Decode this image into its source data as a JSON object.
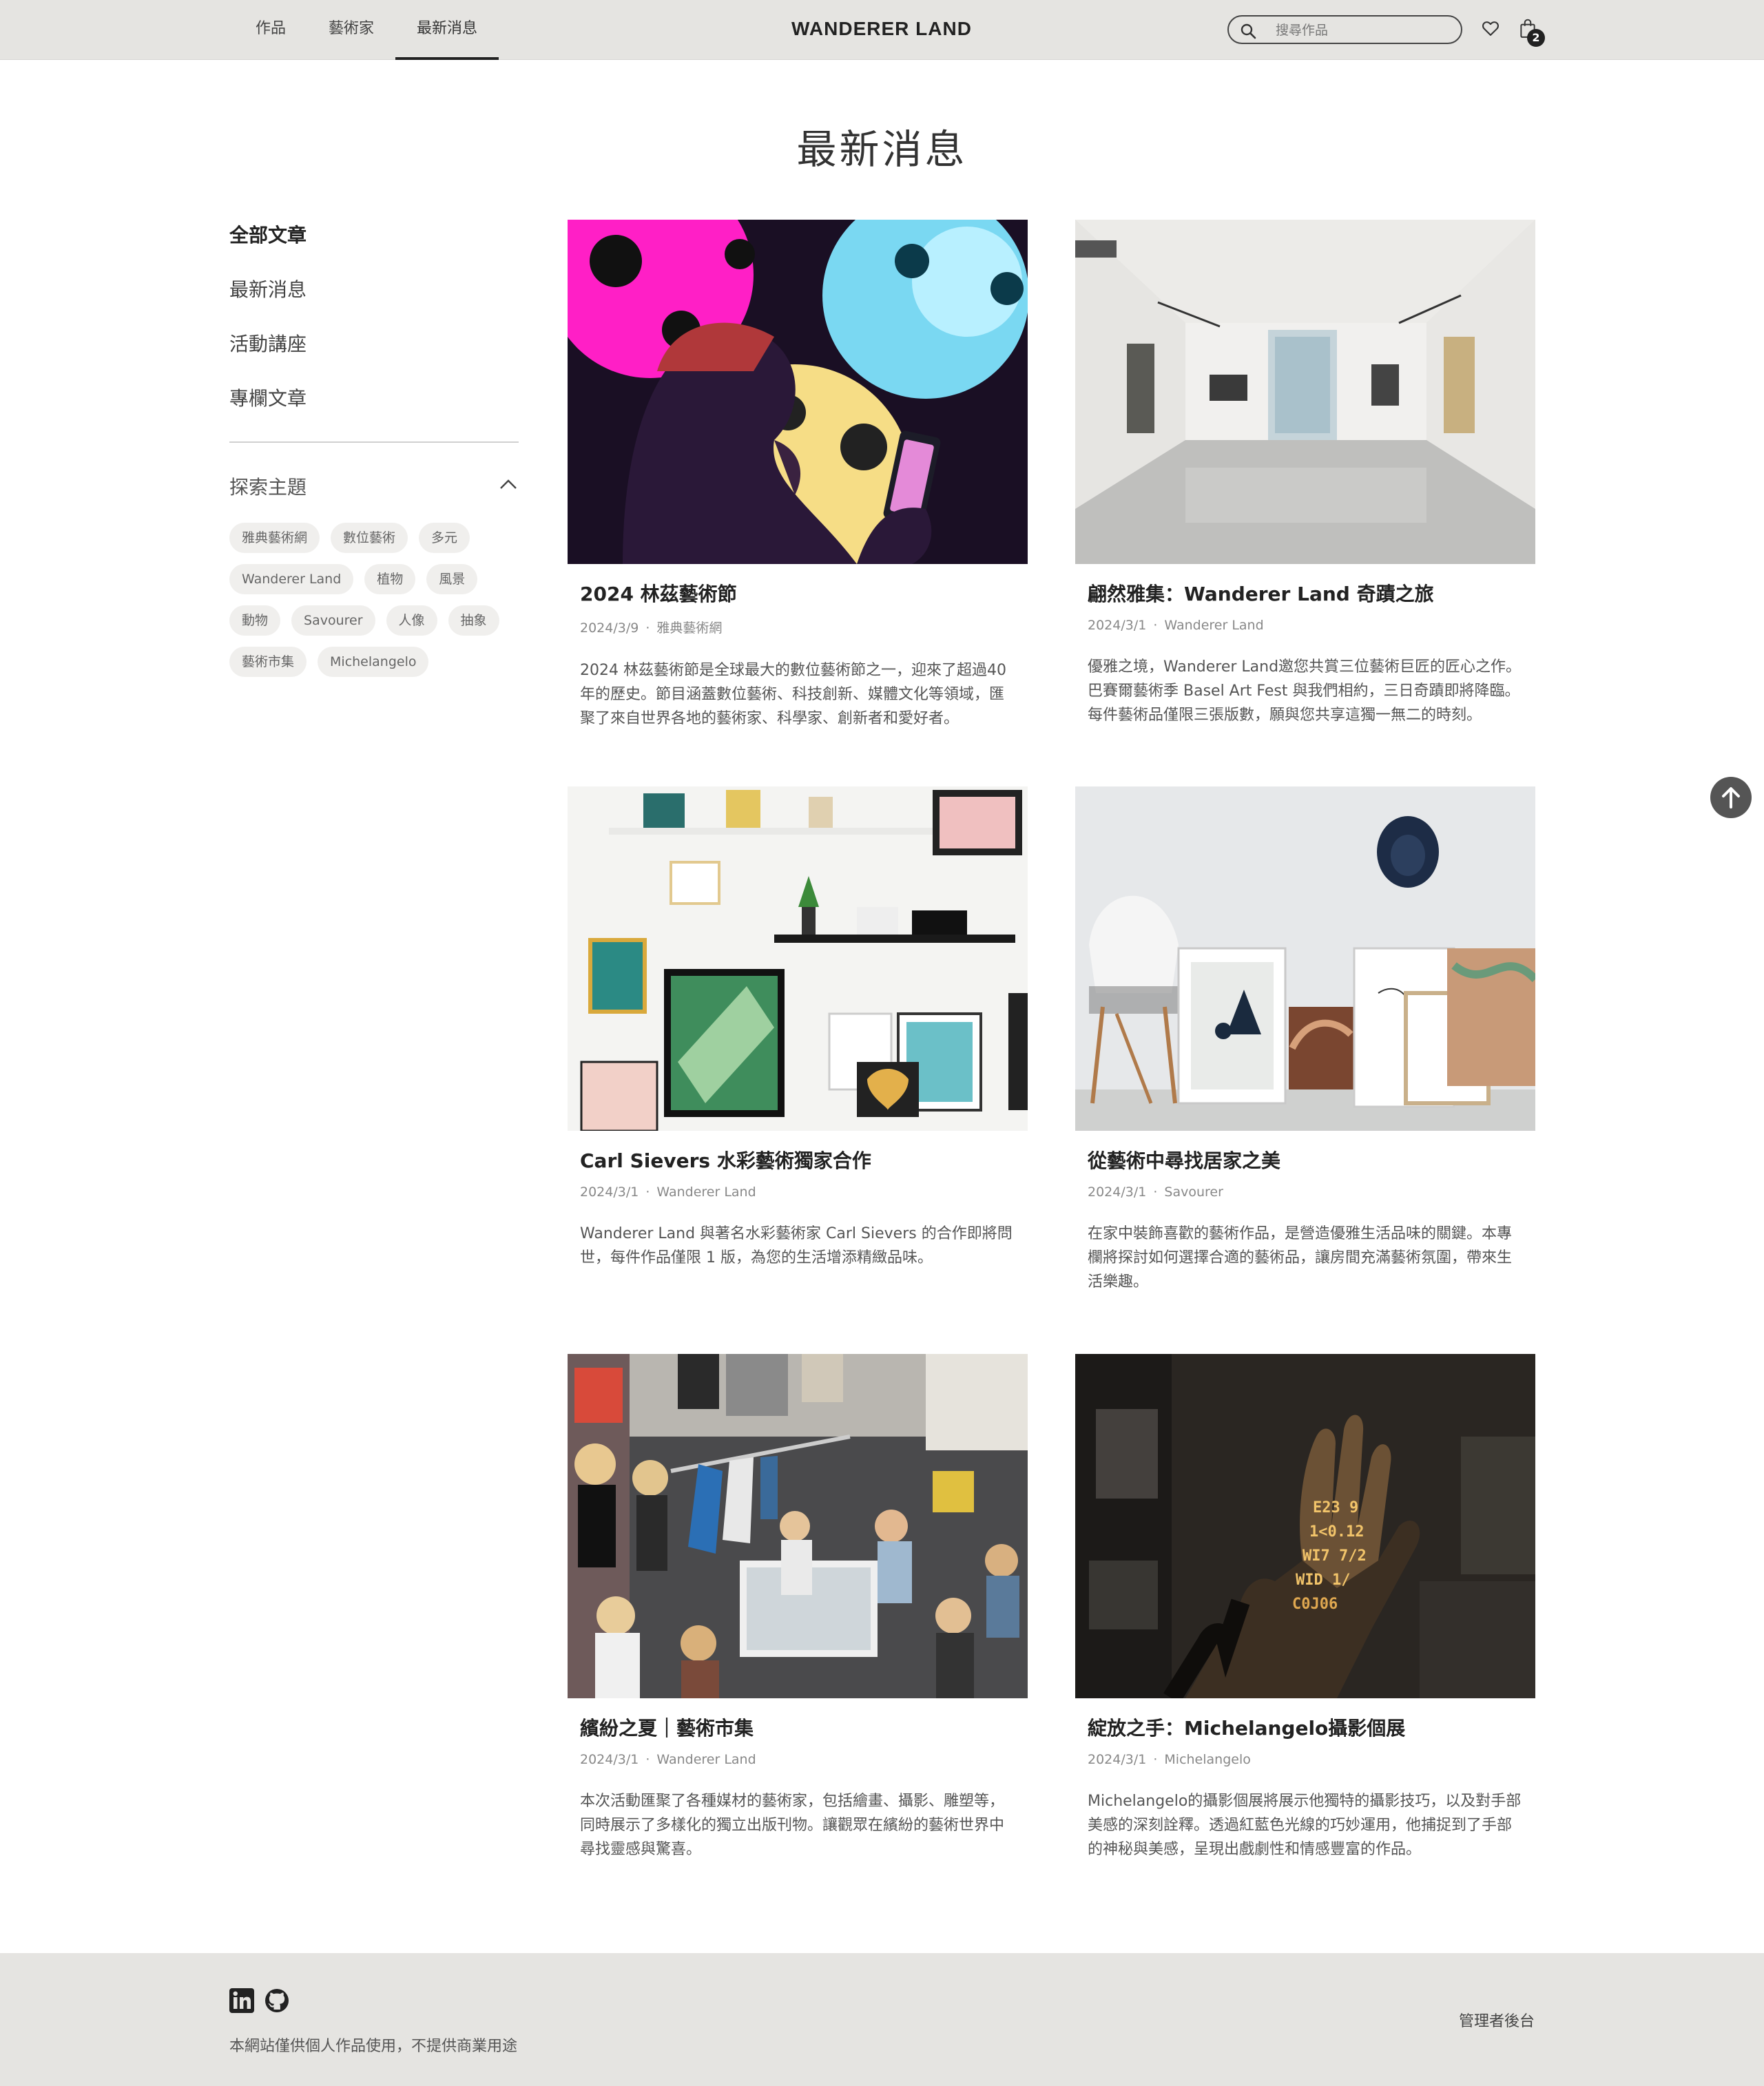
{
  "header": {
    "nav": [
      "作品",
      "藝術家",
      "最新消息"
    ],
    "brand": "WANDERER LAND",
    "search_placeholder": "搜尋作品",
    "cart_count": "2"
  },
  "page": {
    "title": "最新消息"
  },
  "sidebar": {
    "links": [
      "全部文章",
      "最新消息",
      "活動講座",
      "專欄文章"
    ],
    "explore_title": "探索主題",
    "tags": [
      "雅典藝術網",
      "數位藝術",
      "多元",
      "Wanderer Land",
      "植物",
      "風景",
      "動物",
      "Savourer",
      "人像",
      "抽象",
      "藝術市集",
      "Michelangelo"
    ]
  },
  "articles": [
    {
      "title": "2024 林茲藝術節",
      "date": "2024/3/9",
      "source": "雅典藝術網",
      "excerpt": "2024 林茲藝術節是全球最大的數位藝術節之一，迎來了超過40年的歷史。節目涵蓋數位藝術、科技創新、媒體文化等領域，匯聚了來自世界各地的藝術家、科學家、創新者和愛好者。"
    },
    {
      "title": "翩然雅集：Wanderer Land 奇蹟之旅",
      "date": "2024/3/1",
      "source": "Wanderer Land",
      "excerpt": "優雅之境，Wanderer Land邀您共賞三位藝術巨匠的匠心之作。巴賽爾藝術季 Basel Art Fest 與我們相約，三日奇蹟即將降臨。每件藝術品僅限三張版數，願與您共享這獨一無二的時刻。"
    },
    {
      "title": "Carl Sievers 水彩藝術獨家合作",
      "date": "2024/3/1",
      "source": "Wanderer Land",
      "excerpt": "Wanderer Land 與著名水彩藝術家 Carl Sievers 的合作即將問世，每件作品僅限 1 版，為您的生活增添精緻品味。"
    },
    {
      "title": "從藝術中尋找居家之美",
      "date": "2024/3/1",
      "source": "Savourer",
      "excerpt": "在家中裝飾喜歡的藝術作品，是營造優雅生活品味的關鍵。本專欄將探討如何選擇合適的藝術品，讓房間充滿藝術氛圍，帶來生活樂趣。"
    },
    {
      "title": "繽紛之夏｜藝術市集",
      "date": "2024/3/1",
      "source": "Wanderer Land",
      "excerpt": "本次活動匯聚了各種媒材的藝術家，包括繪畫、攝影、雕塑等，同時展示了多樣化的獨立出版刊物。讓觀眾在繽紛的藝術世界中尋找靈感與驚喜。"
    },
    {
      "title": "綻放之手：Michelangelo攝影個展",
      "date": "2024/3/1",
      "source": "Michelangelo",
      "excerpt": "Michelangelo的攝影個展將展示他獨特的攝影技巧，以及對手部美感的深刻詮釋。透過紅藍色光線的巧妙運用，他捕捉到了手部的神秘與美感，呈現出戲劇性和情感豐富的作品。"
    }
  ],
  "footer": {
    "note": "本網站僅供個人作品使用，不提供商業用途",
    "admin": "管理者後台"
  }
}
